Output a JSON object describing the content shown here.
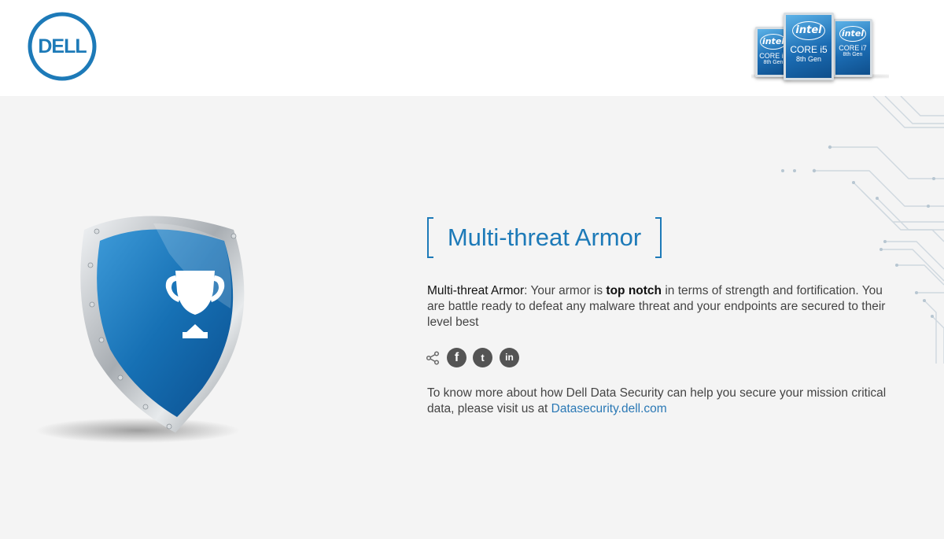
{
  "header": {
    "logo_text": "DELL",
    "badges": [
      {
        "brand": "intel",
        "core": "CORE i3",
        "gen": "8th Gen"
      },
      {
        "brand": "intel",
        "core": "CORE i5",
        "gen": "8th Gen"
      },
      {
        "brand": "intel",
        "core": "CORE i7",
        "gen": "8th Gen"
      }
    ]
  },
  "hero": {
    "shield_icon": "trophy-shield-icon"
  },
  "content": {
    "title": "Multi-threat Armor",
    "description": {
      "lead": "Multi-threat Armor",
      "part1": ": Your armor is ",
      "emphasis": "top notch",
      "part2": " in terms of strength and fortification. You are battle ready to defeat any malware threat and your endpoints are secured to their level best"
    },
    "more_info": {
      "text": "To know more about how Dell Data Security can help you secure your mission critical data, please visit us at ",
      "link": "Datasecurity.dell.com"
    }
  },
  "social": {
    "share_icon": "share-icon",
    "facebook": "f",
    "twitter": "t",
    "linkedin": "in"
  },
  "colors": {
    "accent": "#1d7ab8",
    "link": "#2a78b5",
    "background": "#f4f4f4",
    "social_button": "#545454"
  }
}
